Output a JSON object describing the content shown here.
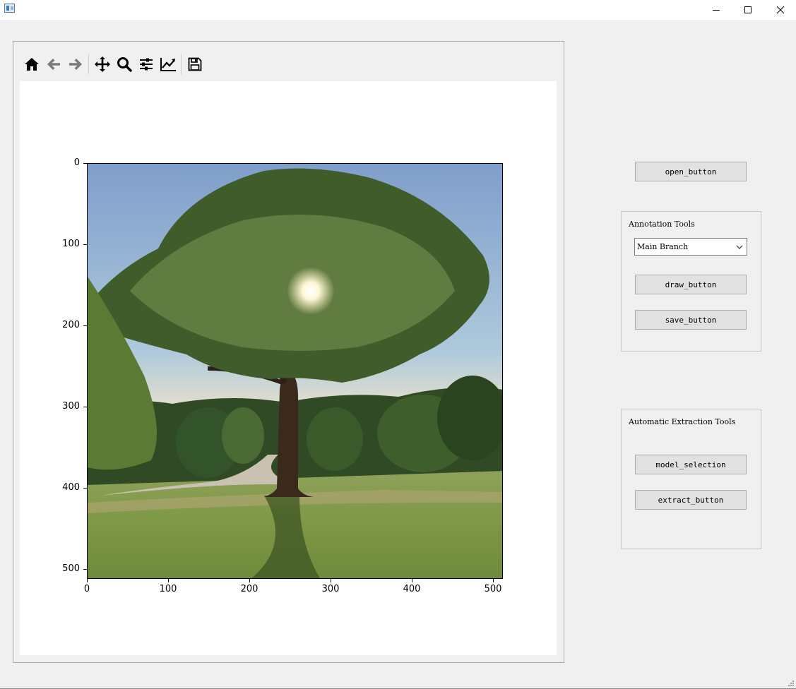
{
  "window": {
    "title": "",
    "controls": [
      "minimize-icon",
      "maximize-icon",
      "close-icon"
    ]
  },
  "toolbar": {
    "icons": [
      "home-icon",
      "back-arrow-icon",
      "forward-arrow-icon",
      "pan-icon",
      "zoom-icon",
      "subplots-config-icon",
      "edit-axis-icon",
      "save-icon"
    ]
  },
  "plot": {
    "y_ticks": [
      "0",
      "100",
      "200",
      "300",
      "400",
      "500"
    ],
    "x_ticks": [
      "0",
      "100",
      "200",
      "300",
      "400",
      "500"
    ],
    "image_extent": [
      0,
      512
    ]
  },
  "buttons": {
    "open": "open_button",
    "draw": "draw_button",
    "save": "save_button",
    "model": "model_selection",
    "extract": "extract_button"
  },
  "annotation": {
    "title": "Annotation Tools",
    "combo_value": "Main Branch"
  },
  "extraction": {
    "title": "Automatic Extraction Tools"
  }
}
